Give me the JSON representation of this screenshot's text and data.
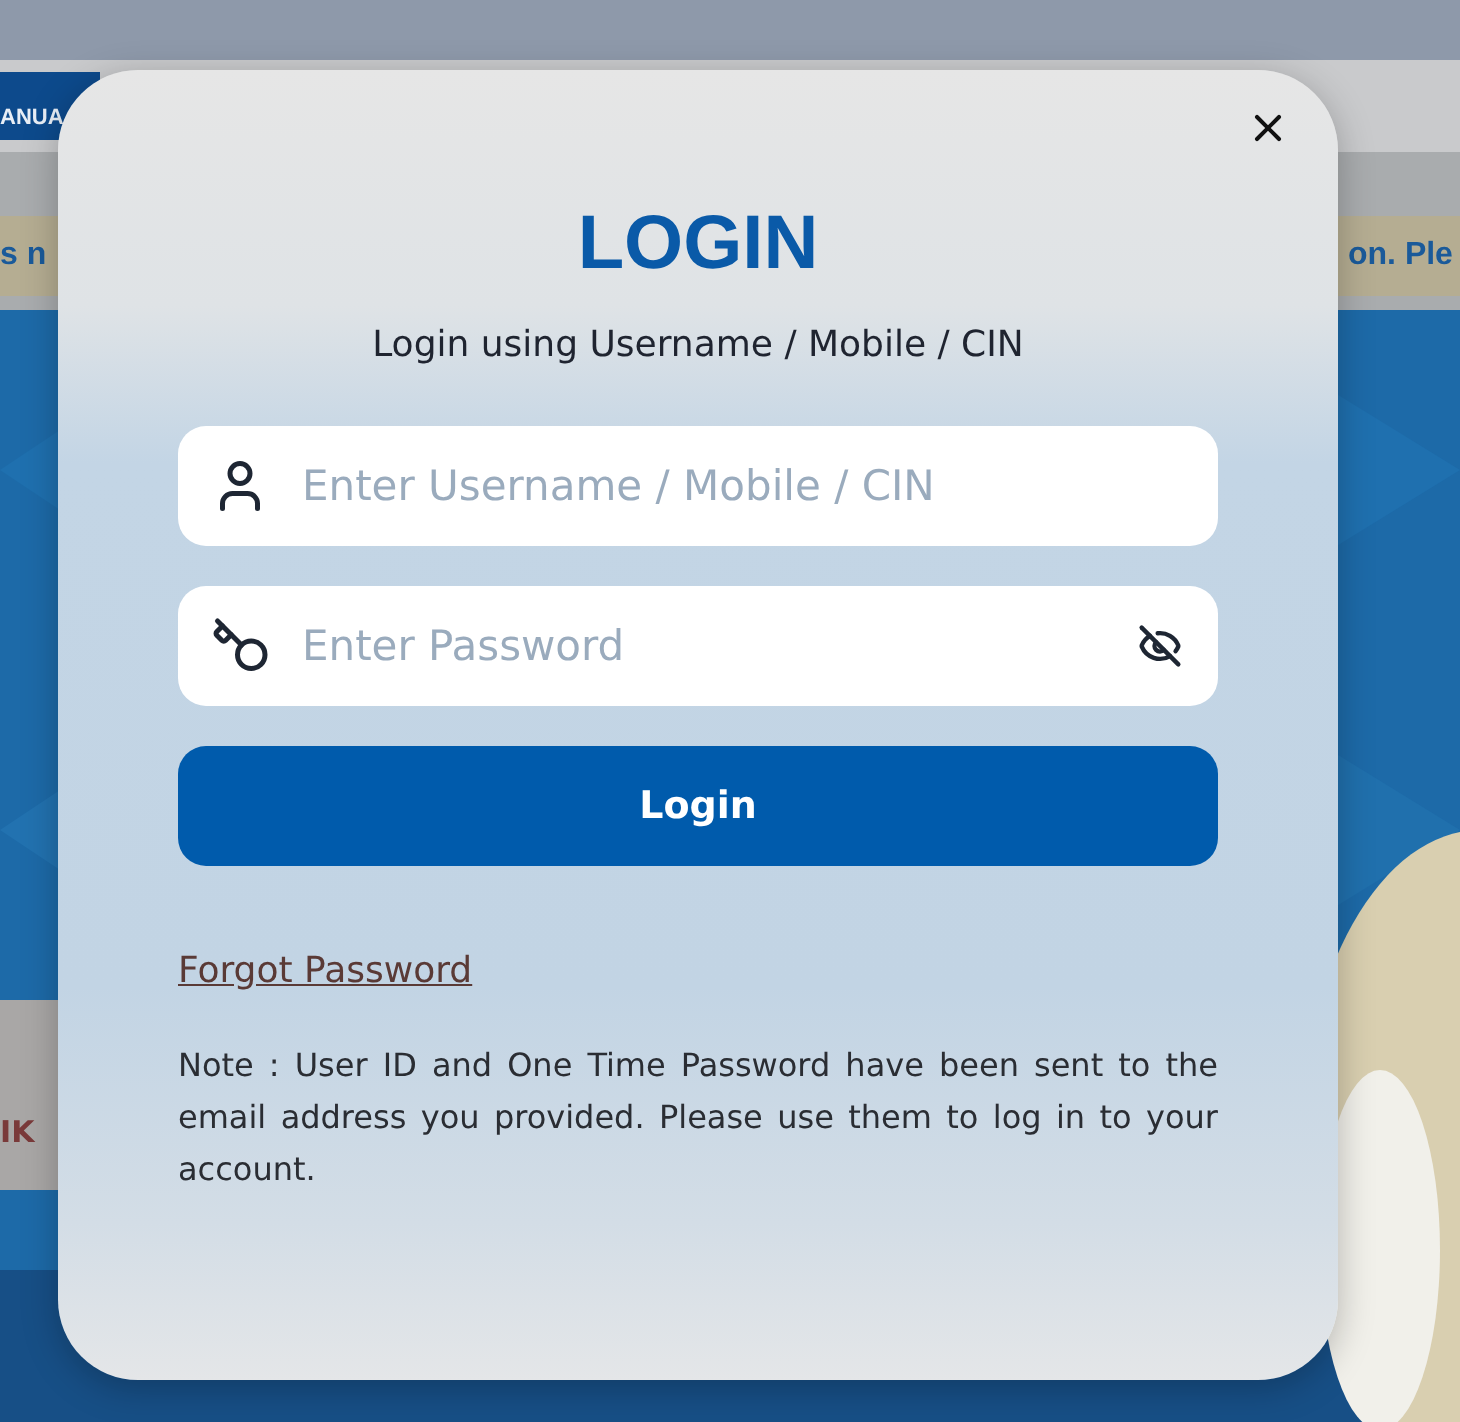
{
  "background": {
    "nav_button": "ANUA",
    "notice_left": "s n",
    "notice_right": "on. Ple",
    "card_text": "IK"
  },
  "dialog": {
    "title": "LOGIN",
    "subtitle": "Login using Username / Mobile / CIN",
    "username": {
      "placeholder": "Enter Username / Mobile / CIN"
    },
    "password": {
      "placeholder": "Enter Password",
      "visible": false
    },
    "submit": "Login",
    "forgot_link": "Forgot Password",
    "note": "Note : User ID and One Time Password have been sent to the email address you provided. Please use them to log in to your account."
  }
}
